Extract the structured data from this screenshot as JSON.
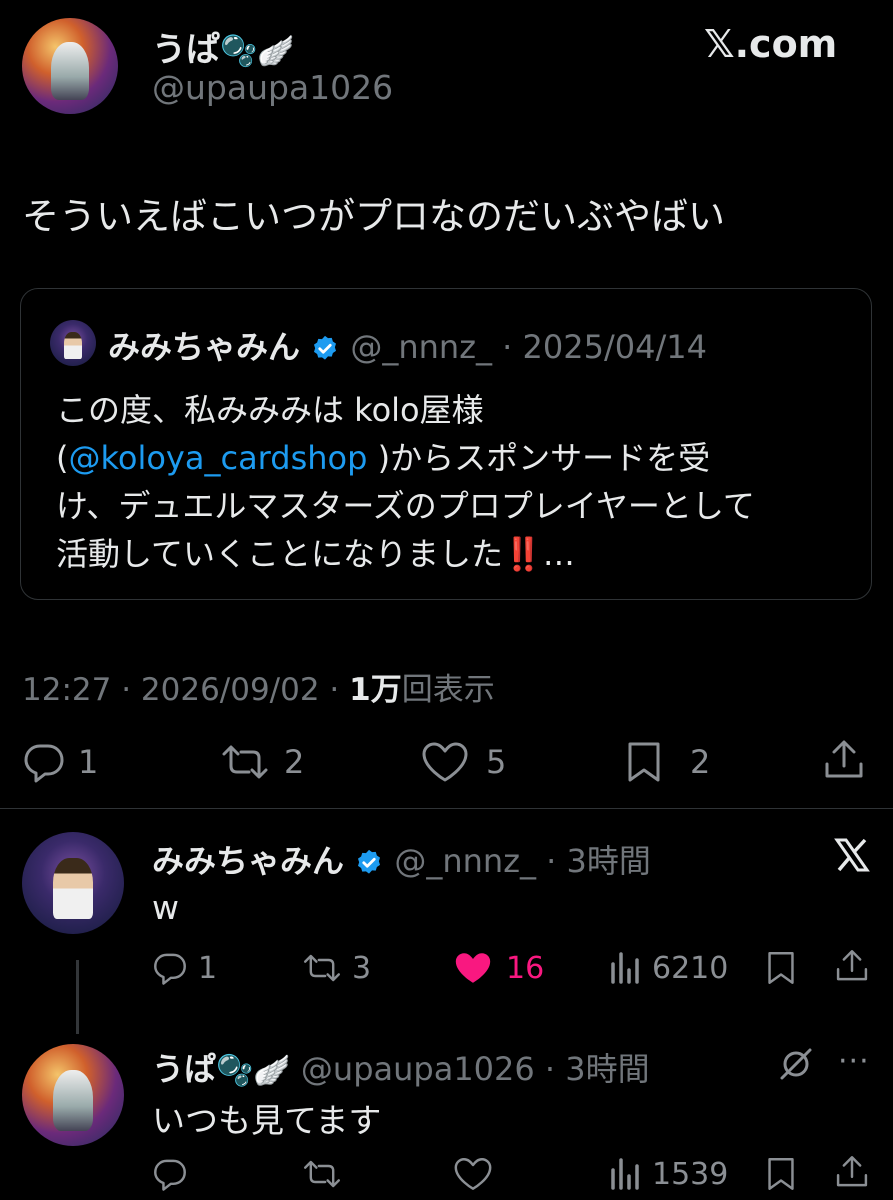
{
  "header": {
    "author_name": "うぱ",
    "author_emoji": "🫧🪽",
    "author_handle": "@upaupa1026",
    "site_logo": "𝕏.com"
  },
  "post": {
    "text": "そういえばこいつがプロなのだいぶやばい",
    "meta_time": "12:27 · 2026/09/02 · ",
    "meta_views_num": "1万",
    "meta_views_label": "回表示",
    "reply_count": "1",
    "repost_count": "2",
    "like_count": "5",
    "bookmark_count": "2"
  },
  "quote": {
    "name": "みみちゃみん",
    "handle": "@_nnnz_",
    "date": "· 2025/04/14",
    "line1": "この度、私みみみは kolo屋様",
    "mention": "@koloya_cardshop",
    "line2_rest": ")からスポンサードを受",
    "line3": "け、デュエルマスターズのプロプレイヤーとして",
    "line4": "活動していくことになりました",
    "line4_emoji": "‼️",
    "line4_ellipsis": "…"
  },
  "reply1": {
    "name": "みみちゃみん",
    "handle": "@_nnnz_",
    "time": "· 3時間",
    "text": "w",
    "reply_count": "1",
    "repost_count": "3",
    "like_count": "16",
    "views": "6210"
  },
  "reply2": {
    "name": "うぱ",
    "author_emoji": "🫧🪽",
    "handle": "@upaupa1026",
    "time": "· 3時間",
    "text": "いつも見てます",
    "views": "1539"
  },
  "colors": {
    "background": "#000000",
    "text": "#e7e9ea",
    "muted": "#71767b",
    "link": "#1d9bf0",
    "like_active": "#f91880",
    "verified": "#1d9bf0"
  }
}
